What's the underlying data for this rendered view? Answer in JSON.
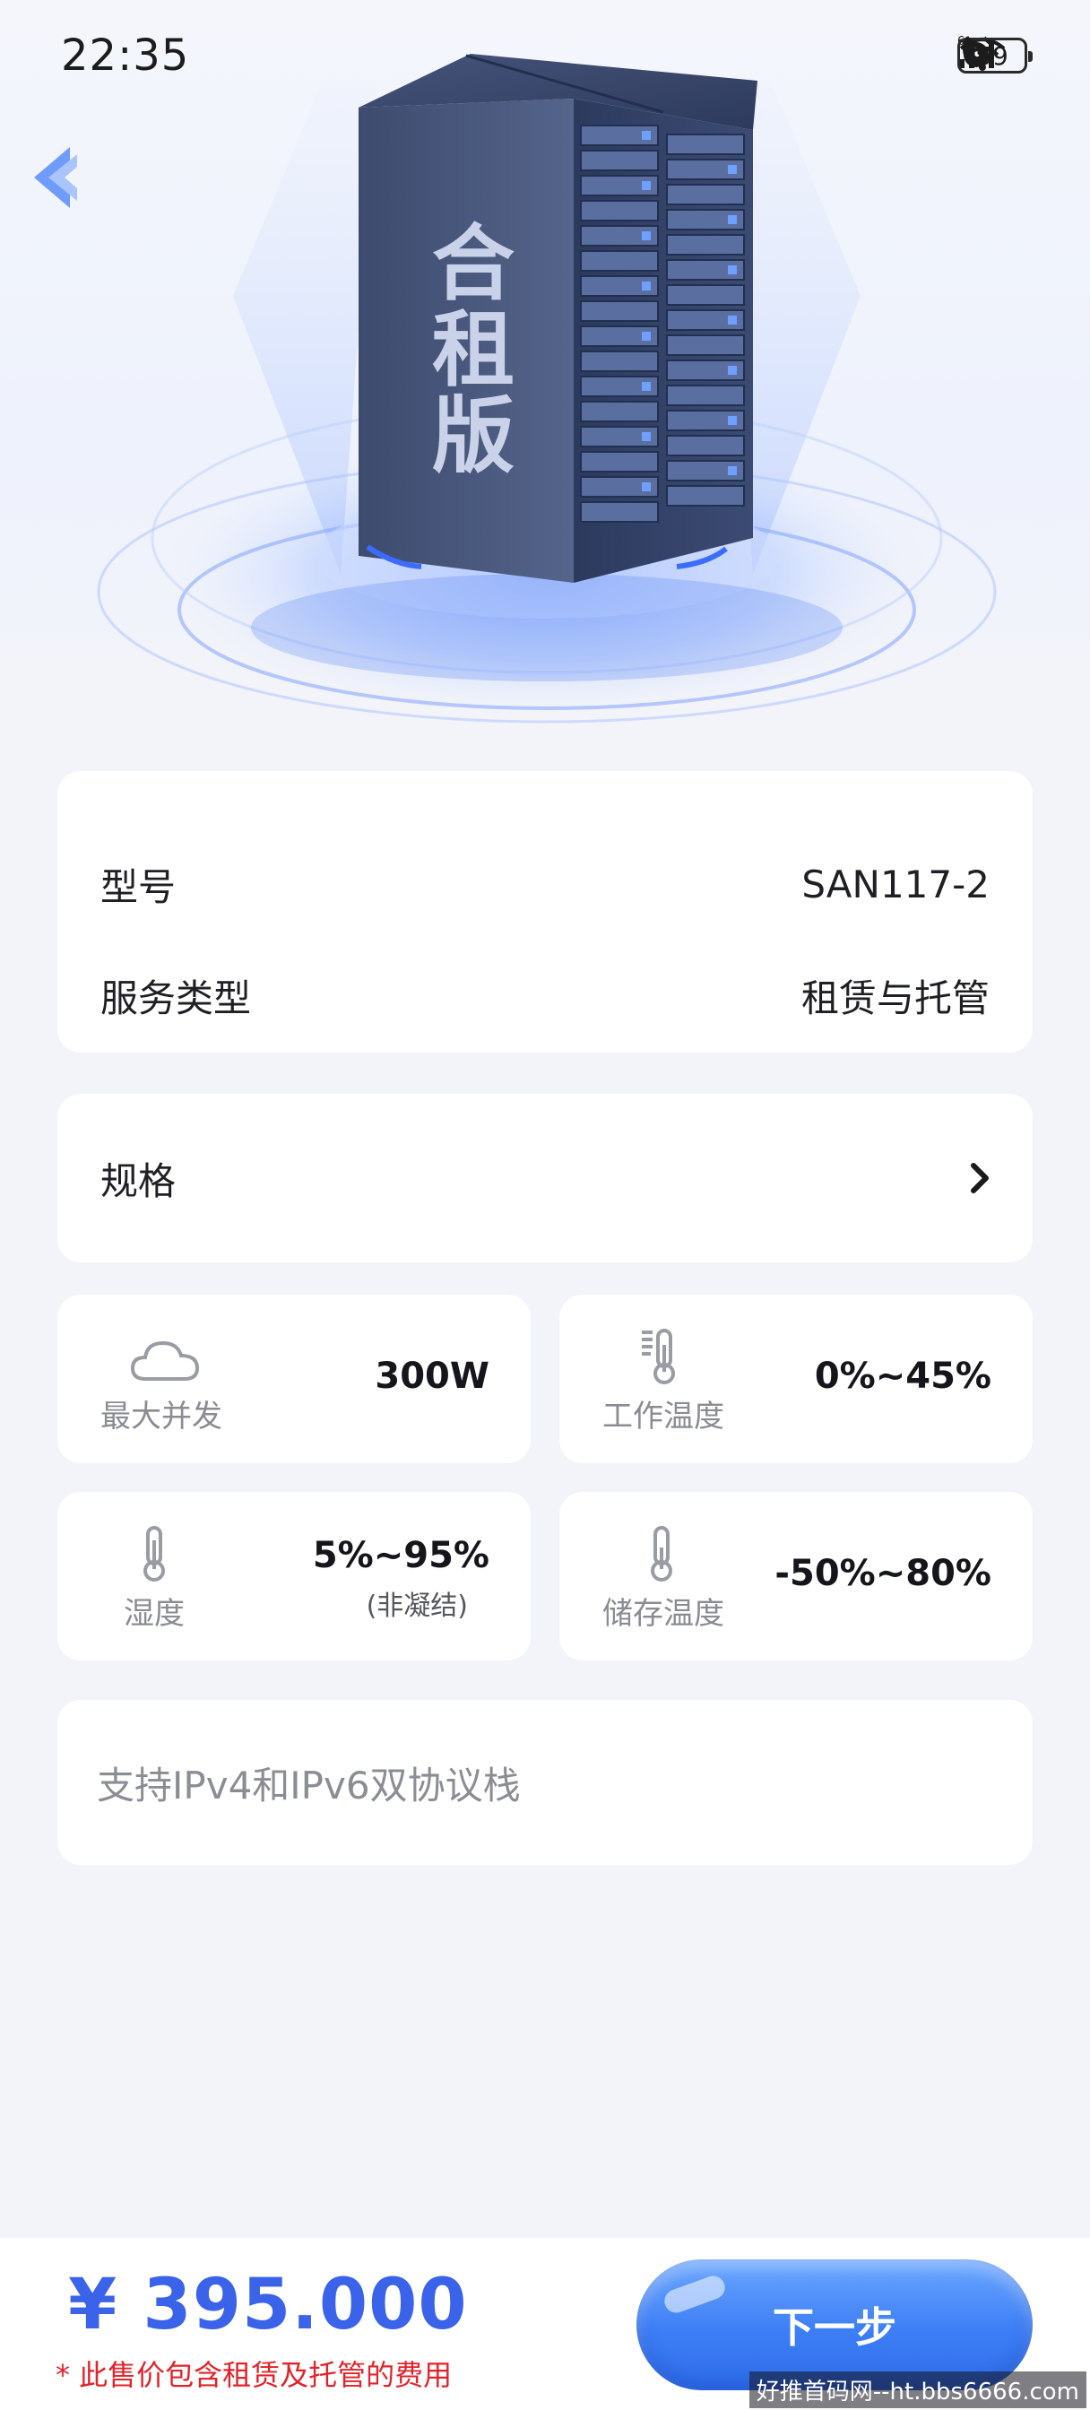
{
  "status_bar": {
    "time": "22:35",
    "battery": "59",
    "icons": [
      "alarm-icon",
      "wifi-6-icon",
      "signal-icon",
      "signal-icon",
      "battery-icon",
      "leaf-icon"
    ]
  },
  "hero": {
    "product_label": "合租版"
  },
  "info": {
    "model_label": "型号",
    "model_value": "SAN117-2",
    "service_label": "服务类型",
    "service_value": "租赁与托管"
  },
  "spec": {
    "label": "规格"
  },
  "tiles": {
    "concurrency": {
      "label": "最大并发",
      "value": "300W",
      "icon": "cloud-icon"
    },
    "work_temp": {
      "label": "工作温度",
      "value": "0%~45%",
      "icon": "thermometer-levels-icon"
    },
    "humidity": {
      "label": "湿度",
      "value": "5%~95%",
      "sub": "(非凝结)",
      "icon": "thermometer-icon"
    },
    "storage_temp": {
      "label": "储存温度",
      "value": "-50%~80%",
      "icon": "thermometer-icon"
    }
  },
  "note": {
    "text": "支持IPv4和IPv6双协议栈"
  },
  "footer": {
    "price": "¥ 395.000",
    "price_note": "* 此售价包含租赁及托管的费用",
    "next_label": "下一步",
    "watermark": "好推首码网--ht.bbs6666.com"
  },
  "colors": {
    "accent": "#3b63ea",
    "warning": "#e2232b",
    "button": "#3d7ef5"
  }
}
